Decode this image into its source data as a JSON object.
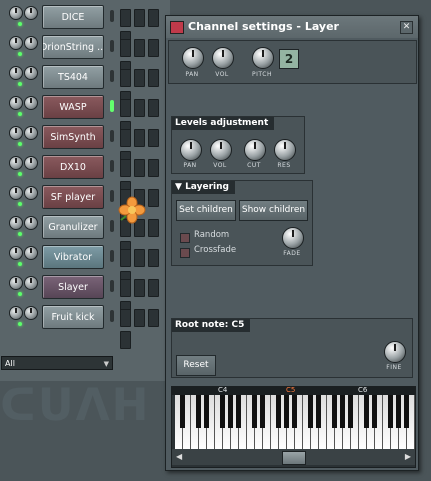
{
  "channels": [
    {
      "name": "DICE",
      "color": "gray",
      "selected": false
    },
    {
      "name": "OrionString ...",
      "color": "gray",
      "selected": false
    },
    {
      "name": "TS404",
      "color": "gray",
      "selected": false
    },
    {
      "name": "WASP",
      "color": "red",
      "selected": true
    },
    {
      "name": "SimSynth",
      "color": "red",
      "selected": false
    },
    {
      "name": "DX10",
      "color": "red",
      "selected": false
    },
    {
      "name": "SF player",
      "color": "red",
      "selected": false
    },
    {
      "name": "Granulizer",
      "color": "gray",
      "selected": false
    },
    {
      "name": "Vibrator",
      "color": "teal",
      "selected": false
    },
    {
      "name": "Slayer",
      "color": "purple",
      "selected": false
    },
    {
      "name": "Fruit kick",
      "color": "gray",
      "selected": false
    }
  ],
  "filter": {
    "value": "All"
  },
  "window": {
    "title": "Channel settings - Layer",
    "top_knobs": {
      "pan": "PAN",
      "vol": "VOL",
      "pitch": "PITCH",
      "pitch_value": "2"
    },
    "levels": {
      "title": "Levels adjustment",
      "labels": [
        "PAN",
        "VOL",
        "CUT",
        "RES"
      ]
    },
    "layering": {
      "title": "Layering",
      "set_children": "Set children",
      "show_children": "Show children",
      "random": "Random",
      "crossfade": "Crossfade",
      "fade": "FADE"
    },
    "root": {
      "title": "Root note: C5",
      "reset": "Reset",
      "fine": "FINE"
    },
    "keyboard": {
      "octaves": [
        "C4",
        "C5",
        "C6"
      ],
      "current": "C5"
    }
  }
}
